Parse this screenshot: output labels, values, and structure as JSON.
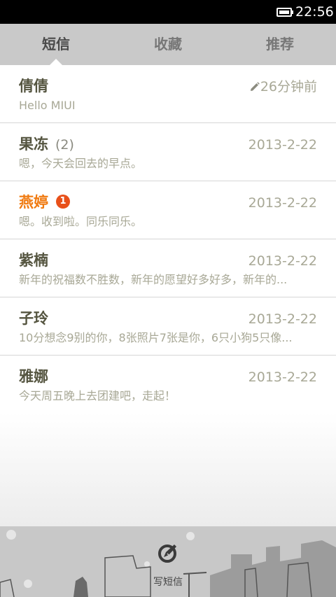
{
  "status_bar": {
    "time": "22:56"
  },
  "tabs": [
    {
      "label": "短信"
    },
    {
      "label": "收藏"
    },
    {
      "label": "推荐"
    }
  ],
  "conversations": [
    {
      "name": "倩倩",
      "count": "",
      "date": "26分钟前",
      "preview": "Hello MIUI",
      "unread_badge": ""
    },
    {
      "name": "果冻",
      "count": "(2)",
      "date": "2013-2-22",
      "preview": "嗯，今天会回去的早点。",
      "unread_badge": ""
    },
    {
      "name": "燕婷",
      "count": "",
      "date": "2013-2-22",
      "preview": "嗯。收到啦。同乐同乐。",
      "unread_badge": "1"
    },
    {
      "name": "紫楠",
      "count": "",
      "date": "2013-2-22",
      "preview": "新年的祝福数不胜数，新年的愿望好多好多，新年的...",
      "unread_badge": ""
    },
    {
      "name": "子玲",
      "count": "",
      "date": "2013-2-22",
      "preview": "10分想念9别的你，8张照片7张是你，6只小狗5只像...",
      "unread_badge": ""
    },
    {
      "name": "雅娜",
      "count": "",
      "date": "2013-2-22",
      "preview": "今天周五晚上去团建吧，走起！",
      "unread_badge": ""
    }
  ],
  "compose": {
    "label": "写短信"
  },
  "colors": {
    "accent_unread": "#f07a10",
    "badge": "#e8501a"
  }
}
